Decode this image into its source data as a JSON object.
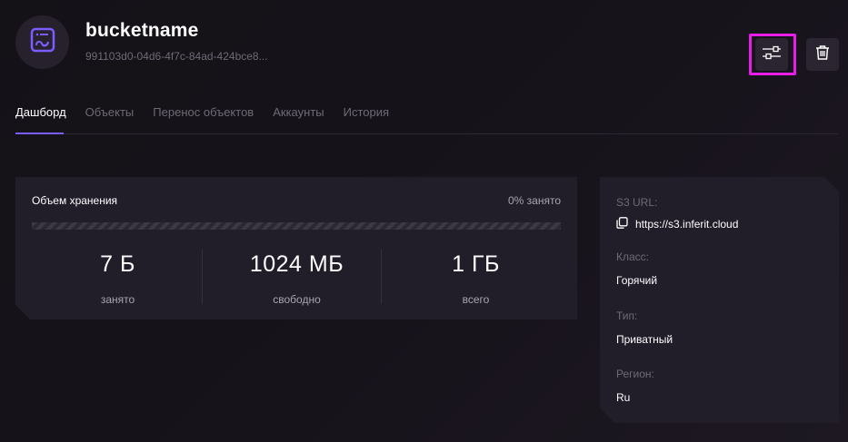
{
  "header": {
    "title": "bucketname",
    "subtitle": "991103d0-04d6-4f7c-84ad-424bce8..."
  },
  "tabs": [
    {
      "label": "Дашборд",
      "active": true
    },
    {
      "label": "Объекты",
      "active": false
    },
    {
      "label": "Перенос объектов",
      "active": false
    },
    {
      "label": "Аккаунты",
      "active": false
    },
    {
      "label": "История",
      "active": false
    }
  ],
  "storage": {
    "title": "Объем хранения",
    "used_text": "0% занято",
    "used_fraction": 0,
    "stats": [
      {
        "value": "7 Б",
        "label": "занято"
      },
      {
        "value": "1024 МБ",
        "label": "свободно"
      },
      {
        "value": "1 ГБ",
        "label": "всего"
      }
    ]
  },
  "info": {
    "url_label": "S3 URL:",
    "url_value": "https://s3.inferit.cloud",
    "class_label": "Класс:",
    "class_value": "Горячий",
    "type_label": "Тип:",
    "type_value": "Приватный",
    "region_label": "Регион:",
    "region_value": "Ru"
  },
  "colors": {
    "accent": "#7a5cff",
    "highlight": "#e81ee8",
    "background": "#151219",
    "card": "#211d29"
  },
  "icons": {
    "avatar": "bucket-icon",
    "settings": "sliders-icon",
    "delete": "trash-icon",
    "copy": "copy-icon"
  }
}
